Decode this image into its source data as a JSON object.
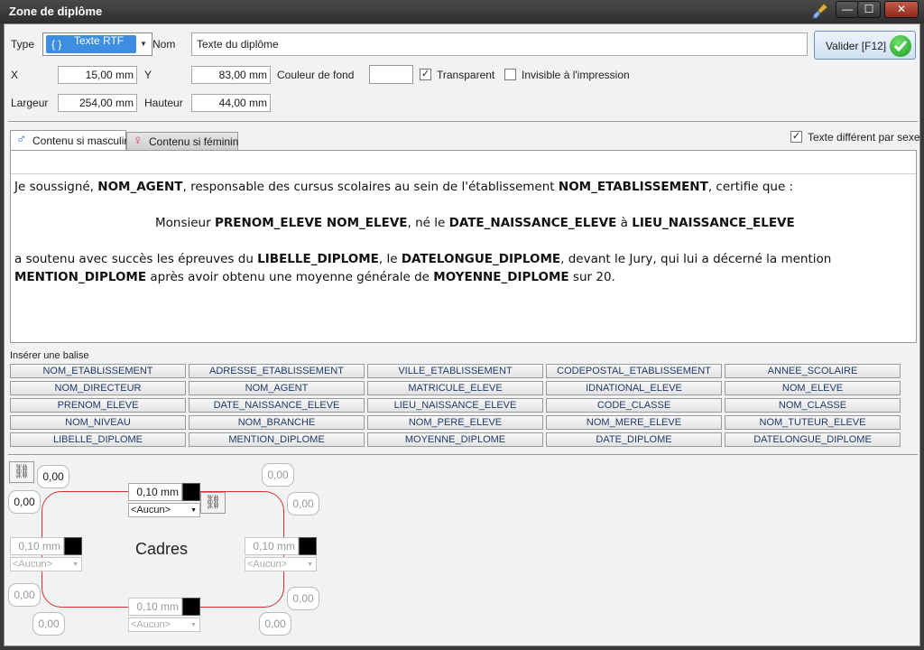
{
  "window": {
    "title": "Zone de diplôme",
    "min": "—",
    "max": "☐",
    "close": "✕"
  },
  "form": {
    "type_label": "Type",
    "type_icon": "{ }",
    "type_value": "Texte RTF",
    "name_label": "Nom",
    "name_value": "Texte du diplôme",
    "validate_label": "Valider [F12]",
    "x_label": "X",
    "x_value": "15,00 mm",
    "y_label": "Y",
    "y_value": "83,00 mm",
    "bg_color_label": "Couleur de fond",
    "transparent_label": "Transparent",
    "transparent_checked": true,
    "invisible_label": "Invisible à l'impression",
    "invisible_checked": false,
    "width_label": "Largeur",
    "width_value": "254,00 mm",
    "height_label": "Hauteur",
    "height_value": "44,00 mm"
  },
  "tabs": [
    {
      "label": "Contenu si masculin",
      "icon": "male-icon",
      "active": true
    },
    {
      "label": "Contenu si féminin",
      "icon": "female-icon",
      "active": false
    }
  ],
  "diff_sex_label": "Texte différent par sexe",
  "diff_sex_checked": true,
  "document": {
    "l1a": "Je soussigné, ",
    "l1b": "NOM_AGENT",
    "l1c": ", responsable des cursus scolaires au sein de l'établissement ",
    "l1d": "NOM_ETABLISSEMENT",
    "l1e": ", certifie que :",
    "l2a": "Monsieur ",
    "l2b": "PRENOM_ELEVE NOM_ELEVE",
    "l2c": ", né le ",
    "l2d": "DATE_NAISSANCE_ELEVE",
    "l2e": " à ",
    "l2f": "LIEU_NAISSANCE_ELEVE",
    "l3a": "a soutenu avec succès les épreuves du ",
    "l3b": "LIBELLE_DIPLOME",
    "l3c": ", le ",
    "l3d": "DATELONGUE_DIPLOME",
    "l3e": ", devant le Jury, qui lui a décerné la mention",
    "l4a": "MENTION_DIPLOME",
    "l4b": " après avoir obtenu une moyenne générale de ",
    "l4c": "MOYENNE_DIPLOME",
    "l4d": " sur 20."
  },
  "insert_tag_label": "Insérer une balise",
  "tags": [
    "NOM_ETABLISSEMENT",
    "ADRESSE_ETABLISSEMENT",
    "VILLE_ETABLISSEMENT",
    "CODEPOSTAL_ETABLISSEMENT",
    "ANNEE_SCOLAIRE",
    "NOM_DIRECTEUR",
    "NOM_AGENT",
    "MATRICULE_ELEVE",
    "IDNATIONAL_ELEVE",
    "NOM_ELEVE",
    "PRENOM_ELEVE",
    "DATE_NAISSANCE_ELEVE",
    "LIEU_NAISSANCE_ELEVE",
    "CODE_CLASSE",
    "NOM_CLASSE",
    "NOM_NIVEAU",
    "NOM_BRANCHE",
    "NOM_PERE_ELEVE",
    "NOM_MERE_ELEVE",
    "NOM_TUTEUR_ELEVE",
    "LIBELLE_DIPLOME",
    "MENTION_DIPLOME",
    "MOYENNE_DIPLOME",
    "DATE_DIPLOME",
    "DATELONGUE_DIPLOME"
  ],
  "frame": {
    "title": "Cadres",
    "corner_value": "0,00",
    "border_width": "0,10 mm",
    "border_style": "<Aucun>"
  }
}
